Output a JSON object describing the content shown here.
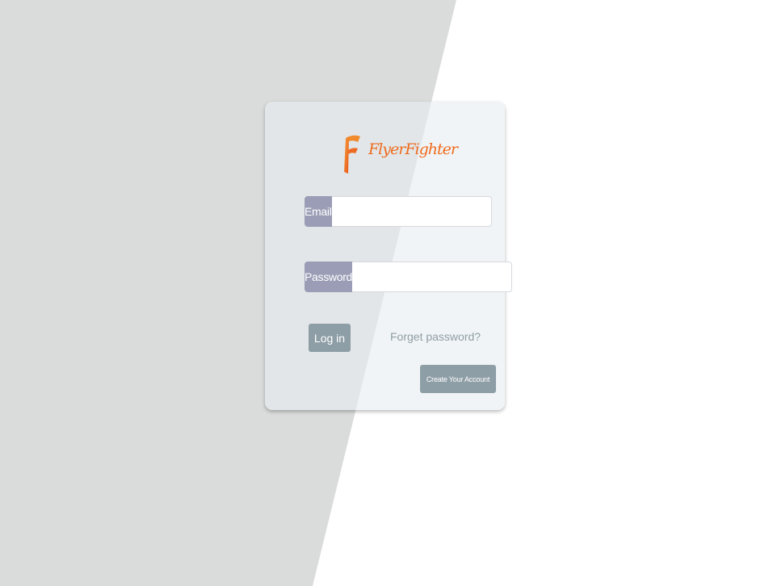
{
  "colors": {
    "background_left": "#dadcdb",
    "background_right": "#ffffff",
    "card_bg": "#e8edf0",
    "label_bg": "#9a9db5",
    "button_bg": "#8e9ea6",
    "brand_orange": "#ee6b1f"
  },
  "logo": {
    "icon": "flyerfighter-f-logo-icon",
    "text": "FlyerFighter"
  },
  "form": {
    "email_label": "Email",
    "email_value": "",
    "password_label": "Password",
    "password_value": ""
  },
  "actions": {
    "login_label": "Log in",
    "forget_label": "Forget password?",
    "create_label": "Create Your Account"
  }
}
